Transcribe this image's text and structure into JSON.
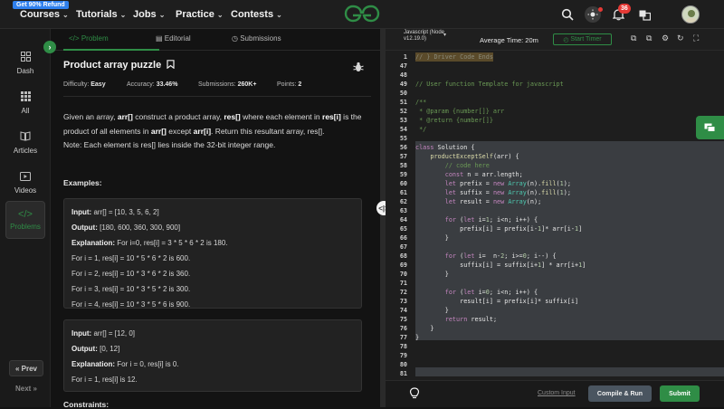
{
  "header": {
    "promo": "Get 90% Refund",
    "nav": [
      "Courses",
      "Tutorials",
      "Jobs",
      "Practice",
      "Contests"
    ],
    "notification_count": "36",
    "icons": [
      "search-icon",
      "theme-toggle-icon",
      "bell-icon",
      "translate-icon",
      "avatar"
    ]
  },
  "sidebar": {
    "items": [
      {
        "label": "Dash",
        "icon": "grid-icon"
      },
      {
        "label": "All",
        "icon": "dots-grid-icon"
      },
      {
        "label": "Articles",
        "icon": "book-icon"
      },
      {
        "label": "Videos",
        "icon": "play-icon"
      },
      {
        "label": "Problems",
        "icon": "code-icon",
        "active": true
      }
    ],
    "prev": "« Prev",
    "next": "Next »"
  },
  "tabs": [
    {
      "label": "Problem",
      "active": true
    },
    {
      "label": "Editorial"
    },
    {
      "label": "Submissions"
    }
  ],
  "problem": {
    "title": "Product array puzzle",
    "difficulty_label": "Difficulty:",
    "difficulty": "Easy",
    "accuracy_label": "Accuracy:",
    "accuracy": "33.46%",
    "submissions_label": "Submissions:",
    "submissions": "260K+",
    "points_label": "Points:",
    "points": "2",
    "desc": {
      "p1": "Given an array, ",
      "b1": "arr[]",
      "p2": " construct a product array, ",
      "b2": "res[]",
      "p3": " where each element in ",
      "b3": "res[i]",
      "p4": " is the product of all elements in ",
      "b4": "arr[]",
      "p5": " except ",
      "b5": "arr[i]",
      "p6": ". Return this resultant array, res[].",
      "note": "Note: Each element is res[] lies inside the 32-bit integer range."
    },
    "examples_heading": "Examples:",
    "example1": {
      "input_label": "Input:",
      "input": "arr[] = [10, 3, 5, 6, 2]",
      "output_label": "Output:",
      "output": "[180, 600, 360, 300, 900]",
      "explanation_label": "Explanation:",
      "explanation": "For i=0, res[i] = 3 * 5 * 6 * 2 is 180.",
      "lines": [
        "For i = 1, res[i] = 10 * 5 * 6 * 2 is 600.",
        "For i = 2, res[i] = 10 * 3 * 6 * 2 is 360.",
        "For i = 3, res[i] = 10 * 3 * 5 * 2 is 300.",
        "For i = 4, res[i] = 10 * 3 * 5 * 6 is 900."
      ]
    },
    "example2": {
      "input_label": "Input:",
      "input": "arr[] = [12, 0]",
      "output_label": "Output:",
      "output": "[0, 12]",
      "explanation_label": "Explanation:",
      "explanation": "For i = 0, res[i] is 0.",
      "lines": [
        "For i = 1, res[i] is 12."
      ]
    },
    "constraints_heading": "Constraints:"
  },
  "editor": {
    "language": "Javascript (Node v12.19.0)",
    "avg_time": "Average Time: 20m",
    "start_timer": "Start Timer",
    "lines": [
      {
        "n": "1",
        "t": "// } Driver Code Ends"
      },
      {
        "n": "47",
        "t": ""
      },
      {
        "n": "48",
        "t": ""
      },
      {
        "n": "49",
        "t": "// User function Template for javascript"
      },
      {
        "n": "50",
        "t": ""
      },
      {
        "n": "51",
        "t": "/**"
      },
      {
        "n": "52",
        "t": " * @param {number[]} arr"
      },
      {
        "n": "53",
        "t": " * @return {number[]}"
      },
      {
        "n": "54",
        "t": " */"
      },
      {
        "n": "55",
        "t": ""
      },
      {
        "n": "56",
        "t": "class Solution {"
      },
      {
        "n": "57",
        "t": "    productExceptSelf(arr) {"
      },
      {
        "n": "58",
        "t": "        // code here"
      },
      {
        "n": "59",
        "t": "        const n = arr.length;"
      },
      {
        "n": "60",
        "t": "        let prefix = new Array(n).fill(1);"
      },
      {
        "n": "61",
        "t": "        let suffix = new Array(n).fill(1);"
      },
      {
        "n": "62",
        "t": "        let result = new Array(n);"
      },
      {
        "n": "63",
        "t": ""
      },
      {
        "n": "64",
        "t": "        for (let i=1; i<n; i++) {"
      },
      {
        "n": "65",
        "t": "            prefix[i] = prefix[i-1]* arr[i-1]"
      },
      {
        "n": "66",
        "t": "        }"
      },
      {
        "n": "67",
        "t": ""
      },
      {
        "n": "68",
        "t": "        for (let i=  n-2; i>=0; i--) {"
      },
      {
        "n": "69",
        "t": "            suffix[i] = suffix[i+1] * arr[i+1]"
      },
      {
        "n": "70",
        "t": "        }"
      },
      {
        "n": "71",
        "t": ""
      },
      {
        "n": "72",
        "t": "        for (let i=0; i<n; i++) {"
      },
      {
        "n": "73",
        "t": "            result[i] = prefix[i]* suffix[i]"
      },
      {
        "n": "74",
        "t": "        }"
      },
      {
        "n": "75",
        "t": "        return result;"
      },
      {
        "n": "76",
        "t": "    }"
      },
      {
        "n": "77",
        "t": "}"
      },
      {
        "n": "78",
        "t": ""
      },
      {
        "n": "79",
        "t": ""
      },
      {
        "n": "80",
        "t": ""
      },
      {
        "n": "81",
        "t": ""
      }
    ],
    "custom_input": "Custom Input",
    "compile_run": "Compile & Run",
    "submit": "Submit"
  },
  "colors": {
    "accent": "#2f8d46",
    "badge": "#e53935",
    "selection": "#3a3d41"
  }
}
